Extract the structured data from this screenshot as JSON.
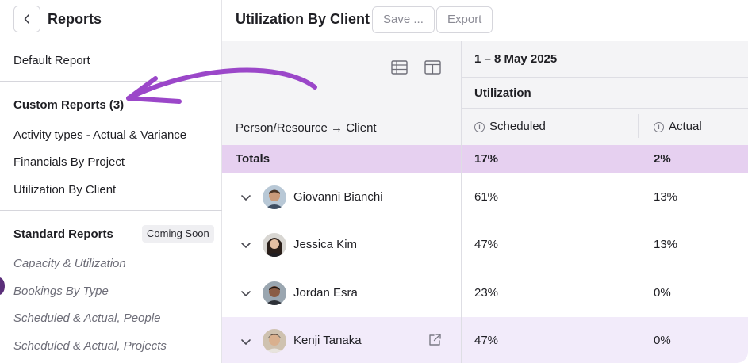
{
  "sidebar": {
    "title": "Reports",
    "default_report": "Default Report",
    "custom_header": "Custom Reports (3)",
    "custom_items": [
      "Activity types - Actual & Variance",
      "Financials By Project",
      "Utilization By Client"
    ],
    "standard_header": "Standard Reports",
    "standard_badge": "Coming Soon",
    "standard_items": [
      "Capacity & Utilization",
      "Bookings By Type",
      "Scheduled & Actual, People",
      "Scheduled & Actual, Projects"
    ]
  },
  "header": {
    "title": "Utilization By Client",
    "save_label": "Save ...",
    "export_label": "Export"
  },
  "table": {
    "date_range": "1 – 8 May 2025",
    "group_label": "Utilization",
    "row_header": "Person/Resource → Client",
    "col_scheduled": "Scheduled",
    "col_actual": "Actual",
    "totals": {
      "label": "Totals",
      "scheduled": "17%",
      "actual": "2%"
    },
    "rows": [
      {
        "name": "Giovanni Bianchi",
        "scheduled": "61%",
        "actual": "13%"
      },
      {
        "name": "Jessica Kim",
        "scheduled": "47%",
        "actual": "13%"
      },
      {
        "name": "Jordan Esra",
        "scheduled": "23%",
        "actual": "0%"
      },
      {
        "name": "Kenji Tanaka",
        "scheduled": "47%",
        "actual": "0%"
      }
    ]
  },
  "colors": {
    "accent": "#9b47c9",
    "totals_bg": "#e6d0f0",
    "hover_row_bg": "#f2ebfa"
  }
}
